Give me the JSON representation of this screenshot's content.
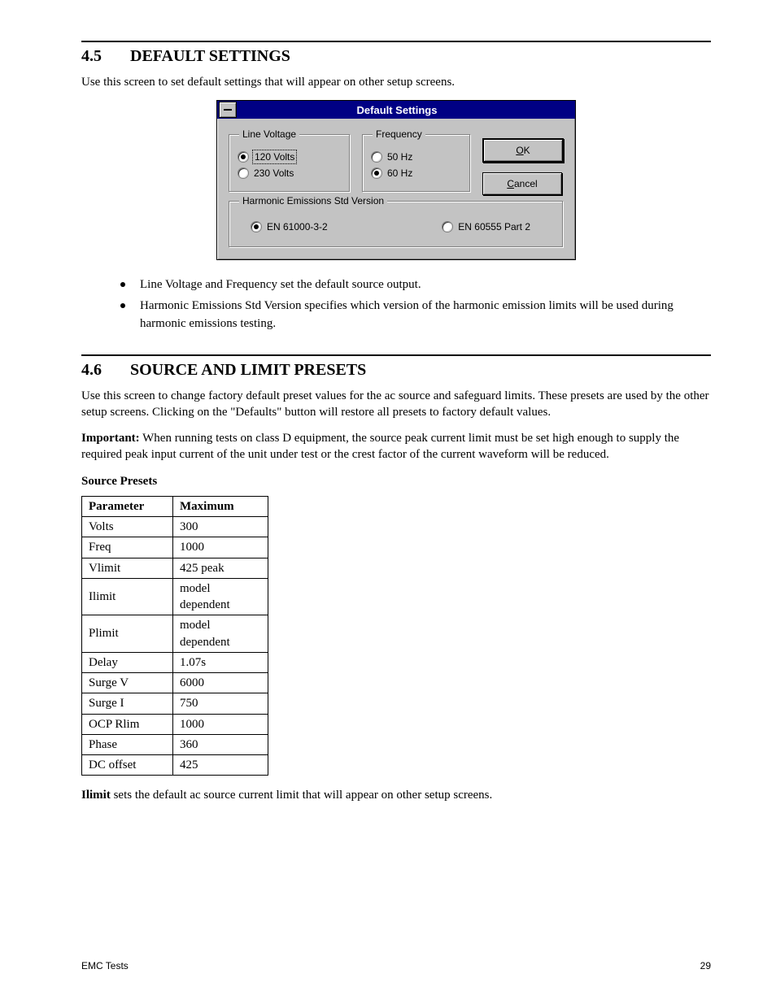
{
  "section1": {
    "number": "4.5",
    "title": "DEFAULT SETTINGS",
    "intro": "Use this screen to set default settings that will appear on other setup screens.",
    "bullets": [
      "Line Voltage and Frequency set the default source output.",
      "Harmonic Emissions Std Version specifies which version of the harmonic emission limits will be used during harmonic emissions testing."
    ]
  },
  "dialog": {
    "title": "Default Settings",
    "line_voltage": {
      "legend": "Line Voltage",
      "opt120": "120 Volts",
      "opt230": "230 Volts",
      "selected": "120"
    },
    "frequency": {
      "legend": "Frequency",
      "opt50": "50 Hz",
      "opt60": "60 Hz",
      "selected": "60"
    },
    "harmonic": {
      "legend": "Harmonic Emissions Std Version",
      "opt1": "EN 61000-3-2",
      "opt2": "EN 60555 Part 2",
      "selected": "1"
    },
    "buttons": {
      "ok_pre": "O",
      "ok_post": "K",
      "cancel_pre": "C",
      "cancel_post": "ancel"
    }
  },
  "section2": {
    "number": "4.6",
    "title": "SOURCE AND LIMIT PRESETS",
    "intro": "Use this screen to change factory default preset values for the ac source and safeguard limits. These presets are used by the other setup screens.  Clicking on the \"Defaults\" button will restore all presets to factory default values.",
    "body_after_table": "sets the default ac source current limit that will appear on other setup screens.",
    "important": [
      "Important:",
      " When running tests on class D equipment, the source peak current limit must be set high enough to supply the required peak input current of the unit under test or the crest factor of the current waveform will be reduced."
    ],
    "table": {
      "headers": [
        "Parameter",
        "Maximum"
      ],
      "rows": [
        [
          "Volts",
          "300"
        ],
        [
          "Freq",
          "1000"
        ],
        [
          "Vlimit",
          "425 peak"
        ],
        [
          "Ilimit",
          "model dependent"
        ],
        [
          "Plimit",
          "model dependent"
        ],
        [
          "Delay",
          "1.07s"
        ],
        [
          "Surge V",
          "6000"
        ],
        [
          "Surge I",
          "750"
        ],
        [
          "OCP Rlim",
          "1000"
        ],
        [
          "Phase",
          "360"
        ],
        [
          "DC offset",
          "425"
        ]
      ]
    },
    "source_presets_label": "Source Presets",
    "ilimit_label": "Ilimit"
  },
  "footer": {
    "left": "EMC Tests",
    "right": "29"
  }
}
